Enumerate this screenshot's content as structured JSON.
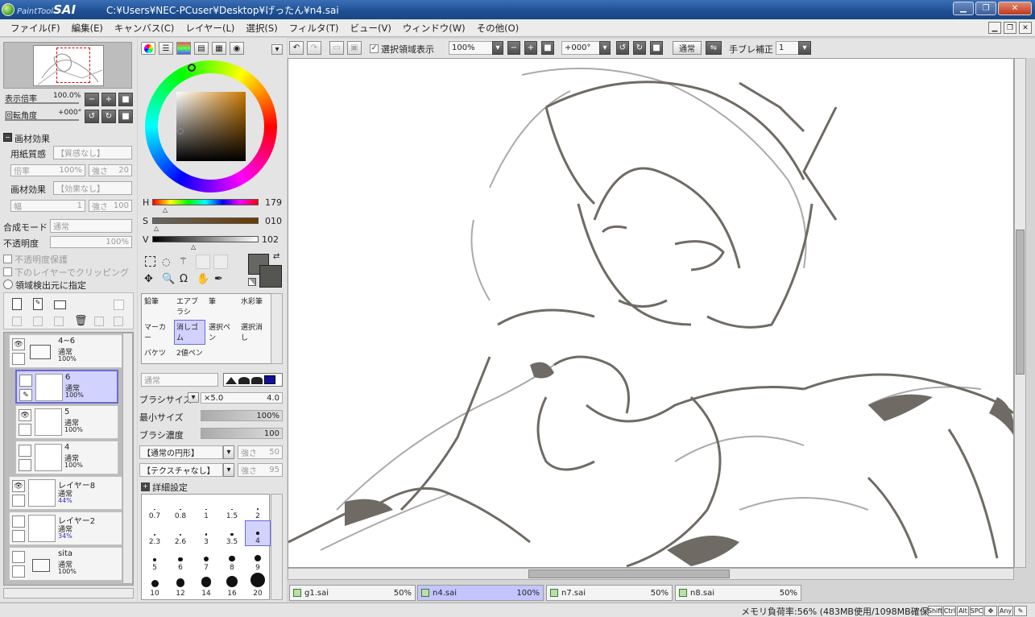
{
  "window": {
    "app_logo_small": "PaintTool",
    "app_logo_big": "SAI",
    "title": "C:¥Users¥NEC-PCuser¥Desktop¥げったん¥n4.sai"
  },
  "menu": [
    "ファイル(F)",
    "編集(E)",
    "キャンバス(C)",
    "レイヤー(L)",
    "選択(S)",
    "フィルタ(T)",
    "ビュー(V)",
    "ウィンドウ(W)",
    "その他(O)"
  ],
  "navigator": {
    "zoom_label": "表示倍率",
    "zoom_value": "100.0%",
    "rotation_label": "回転角度",
    "rotation_value": "+000°"
  },
  "texture": {
    "section_label": "画材効果",
    "paper_label": "用紙質感",
    "paper_value": "【質感なし】",
    "scale_label": "倍率",
    "scale_value": "100%",
    "strength_label": "強さ",
    "strength_value": "20",
    "effect_label": "画材効果",
    "effect_value": "【効果なし】",
    "width_label": "幅",
    "width_value": "1",
    "effect_strength_label": "強さ",
    "effect_strength_value": "100"
  },
  "layer_props": {
    "blend_label": "合成モード",
    "blend_value": "通常",
    "opacity_label": "不透明度",
    "opacity_value": "100%",
    "protect_opacity": "不透明度保護",
    "clip_lower": "下のレイヤーでクリッピング",
    "selection_source": "領域検出元に指定"
  },
  "layers": [
    {
      "name": "4~6",
      "mode": "通常",
      "opacity": "100%",
      "type": "folder"
    },
    {
      "name": "6",
      "mode": "通常",
      "opacity": "100%",
      "type": "layer"
    },
    {
      "name": "5",
      "mode": "通常",
      "opacity": "100%",
      "type": "layer"
    },
    {
      "name": "4",
      "mode": "通常",
      "opacity": "100%",
      "type": "layer"
    },
    {
      "name": "レイヤー8",
      "mode": "通常",
      "opacity": "44%",
      "type": "layer"
    },
    {
      "name": "レイヤー2",
      "mode": "通常",
      "opacity": "34%",
      "type": "layer"
    },
    {
      "name": "sita",
      "mode": "通常",
      "opacity": "100%",
      "type": "folder"
    }
  ],
  "color": {
    "h_label": "H",
    "h_value": "179",
    "s_label": "S",
    "s_value": "010",
    "v_label": "V",
    "v_value": "102",
    "fg_color": "#666662",
    "bg_color": "#555552"
  },
  "tools": [
    {
      "label": "鉛筆"
    },
    {
      "label": "エアブラシ"
    },
    {
      "label": "筆"
    },
    {
      "label": "水彩筆"
    },
    {
      "label": "マーカー"
    },
    {
      "label": "消しゴム"
    },
    {
      "label": "選択ペン"
    },
    {
      "label": "選択消し"
    },
    {
      "label": "バケツ"
    },
    {
      "label": "2値ペン"
    }
  ],
  "brush": {
    "mode_value": "通常",
    "size_label": "ブラシサイズ",
    "size_mult": "×5.0",
    "size_value": "4.0",
    "min_size_label": "最小サイズ",
    "min_size_value": "100%",
    "density_label": "ブラシ濃度",
    "density_value": "100",
    "shape_value": "【通常の円形】",
    "shape_strength_label": "強さ",
    "shape_strength_value": "50",
    "texture_value": "【テクスチャなし】",
    "texture_strength_label": "強さ",
    "texture_strength_value": "95",
    "detail_label": "詳細設定"
  },
  "brush_sizes": [
    "0.7",
    "0.8",
    "1",
    "1.5",
    "2",
    "2.3",
    "2.6",
    "3",
    "3.5",
    "4",
    "5",
    "6",
    "7",
    "8",
    "9",
    "10",
    "12",
    "14",
    "16",
    "20"
  ],
  "toolbar": {
    "selection_display_label": "選択領域表示",
    "zoom_value": "100%",
    "rotation_value": "+000°",
    "blend_button": "通常",
    "stabilizer_label": "手ブレ補正",
    "stabilizer_value": "1"
  },
  "tabs": [
    {
      "name": "g1.sai",
      "zoom": "50%"
    },
    {
      "name": "n4.sai",
      "zoom": "100%"
    },
    {
      "name": "n7.sai",
      "zoom": "50%"
    },
    {
      "name": "n8.sai",
      "zoom": "50%"
    }
  ],
  "status": {
    "memory": "メモリ負荷率:56% (483MB使用/1098MB確保)",
    "keys": [
      "Shift",
      "Ctrl",
      "Alt",
      "SPC",
      "Any"
    ]
  }
}
